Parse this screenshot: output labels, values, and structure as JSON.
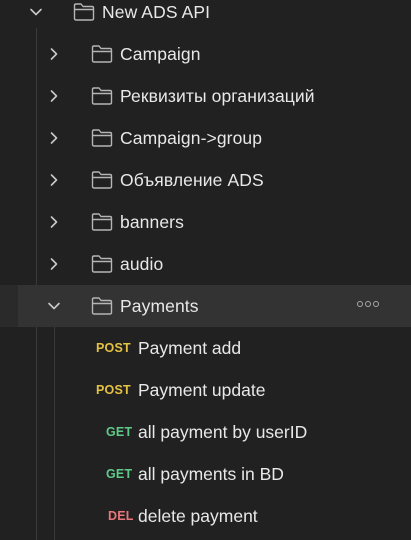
{
  "root": {
    "label": "New ADS API",
    "expanded": true
  },
  "folders": [
    {
      "label": "Campaign",
      "expanded": false
    },
    {
      "label": "Реквизиты организаций",
      "expanded": false
    },
    {
      "label": "Campaign->group",
      "expanded": false
    },
    {
      "label": "Объявление ADS",
      "expanded": false
    },
    {
      "label": "banners",
      "expanded": false
    },
    {
      "label": "audio",
      "expanded": false
    },
    {
      "label": "Payments",
      "expanded": true,
      "selected": true
    }
  ],
  "requests": [
    {
      "method": "POST",
      "label": "Payment add"
    },
    {
      "method": "POST",
      "label": "Payment update"
    },
    {
      "method": "GET",
      "label": "all payment by userID"
    },
    {
      "method": "GET",
      "label": "all payments in BD"
    },
    {
      "method": "DEL",
      "label": "delete payment"
    }
  ],
  "colors": {
    "background": "#212121",
    "selected_row": "#333333",
    "post": "#e5c244",
    "get": "#5fc98a",
    "del": "#e8767a",
    "text": "#e8e8e8",
    "icon": "#b5b5b5"
  },
  "icons": {
    "chevron_collapsed": "chevron-right-icon",
    "chevron_expanded": "chevron-down-icon",
    "folder": "folder-icon",
    "more": "more-options-icon"
  }
}
